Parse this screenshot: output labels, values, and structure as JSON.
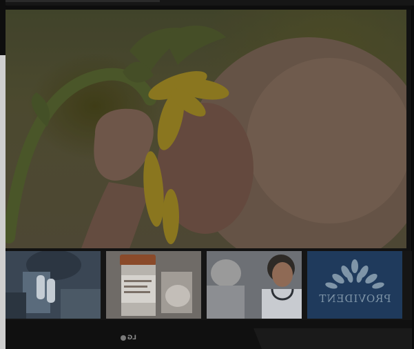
{
  "tv": {
    "brand_text": "LG"
  },
  "thumbnails": [
    {
      "name": "scientist-microscope"
    },
    {
      "name": "pill-bottles"
    },
    {
      "name": "nurse-patient"
    },
    {
      "name": "provident-logo",
      "logo_text": "PROVIDENT"
    }
  ],
  "colors": {
    "logo_tile": "#1f3a5c",
    "bezel": "#101010"
  }
}
